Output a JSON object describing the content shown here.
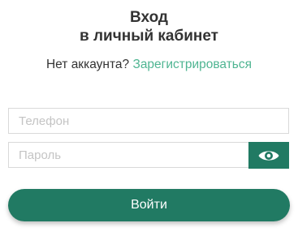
{
  "header": {
    "title_line1": "Вход",
    "title_line2": "в личный кабинет"
  },
  "signup": {
    "prompt": "Нет аккаунта?",
    "link_label": "Зарегистрироваться"
  },
  "form": {
    "phone_placeholder": "Телефон",
    "phone_value": "",
    "password_placeholder": "Пароль",
    "password_value": "",
    "show_password_icon": "eye-icon",
    "submit_label": "Войти"
  },
  "colors": {
    "accent": "#217a63",
    "link": "#4fb592",
    "text": "#333333",
    "placeholder": "#c4c4c4",
    "border": "#d9d9d9"
  }
}
